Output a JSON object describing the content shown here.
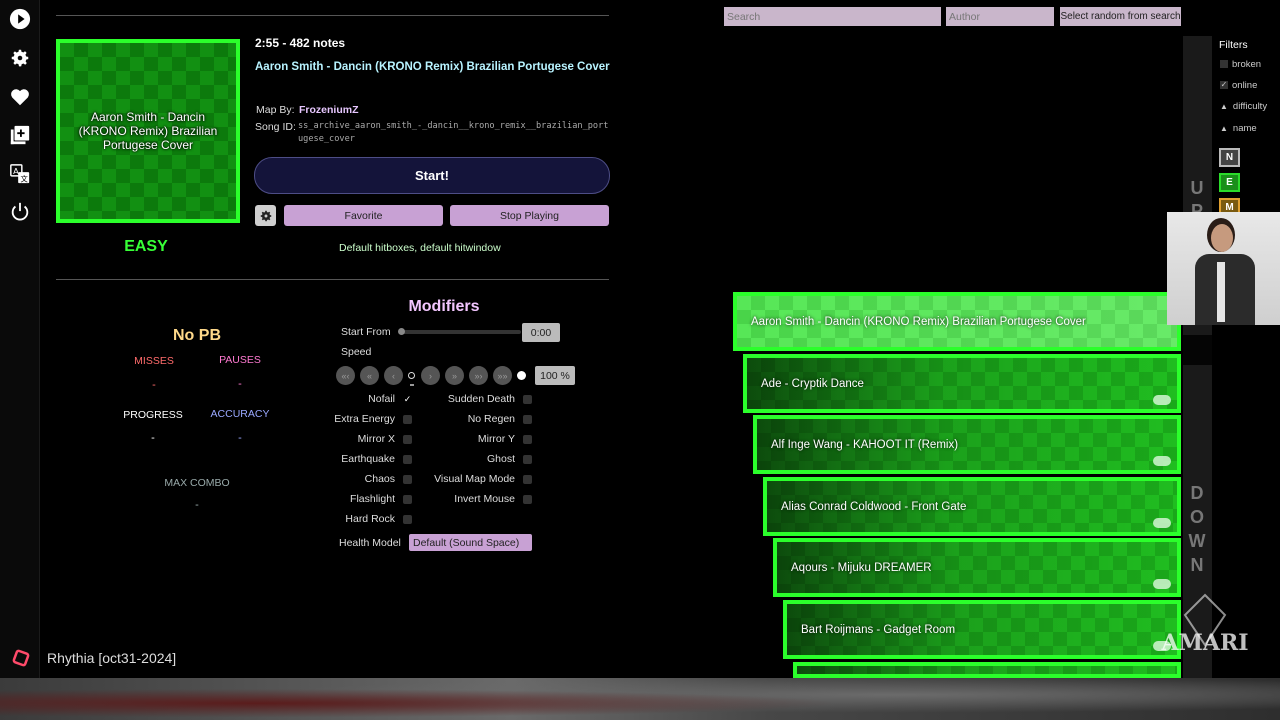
{
  "nav": {
    "items": [
      {
        "name": "play-icon"
      },
      {
        "name": "gear-icon"
      },
      {
        "name": "heart-icon"
      },
      {
        "name": "add-map-icon"
      },
      {
        "name": "translate-icon"
      },
      {
        "name": "power-icon"
      }
    ]
  },
  "details": {
    "cover_title": "Aaron Smith - Dancin (KRONO Remix) Brazilian Portugese Cover",
    "difficulty": "EASY",
    "duration_notes": "2:55 - 482 notes",
    "title": "Aaron Smith - Dancin (KRONO Remix) Brazilian Portugese Cover",
    "map_by_label": "Map By:",
    "map_by": "FrozeniumZ",
    "song_id_label": "Song ID:",
    "song_id": "ss_archive_aaron_smith_-_dancin__krono_remix__brazilian_portugese_cover",
    "start_label": "Start!",
    "favorite_label": "Favorite",
    "stop_label": "Stop Playing",
    "hitbox_note": "Default hitboxes, default hitwindow"
  },
  "stats": {
    "pb": "No PB",
    "misses_label": "MISSES",
    "misses": "-",
    "pauses_label": "PAUSES",
    "pauses": "-",
    "progress_label": "PROGRESS",
    "progress": "-",
    "accuracy_label": "ACCURACY",
    "accuracy": "-",
    "max_combo_label": "MAX COMBO",
    "max_combo": "-"
  },
  "modifiers": {
    "title": "Modifiers",
    "start_from_label": "Start From",
    "start_from": "0:00",
    "start_from_position": 0,
    "speed_label": "Speed",
    "speed_value": "100 %",
    "left_col": [
      {
        "label": "Nofail",
        "checked": "✓"
      },
      {
        "label": "Extra Energy",
        "checked": ""
      },
      {
        "label": "Mirror X",
        "checked": ""
      },
      {
        "label": "Earthquake",
        "checked": ""
      },
      {
        "label": "Chaos",
        "checked": ""
      },
      {
        "label": "Flashlight",
        "checked": ""
      },
      {
        "label": "Hard Rock",
        "checked": ""
      }
    ],
    "right_col": [
      {
        "label": "Sudden Death",
        "checked": ""
      },
      {
        "label": "No Regen",
        "checked": ""
      },
      {
        "label": "Mirror Y",
        "checked": ""
      },
      {
        "label": "Ghost",
        "checked": ""
      },
      {
        "label": "Visual Map Mode",
        "checked": ""
      },
      {
        "label": "Invert Mouse",
        "checked": ""
      }
    ],
    "health_label": "Health Model",
    "health_value": "Default (Sound Space)"
  },
  "search": {
    "search_placeholder": "Search",
    "author_placeholder": "Author",
    "random_label": "Select random from search"
  },
  "filters": {
    "title": "Filters",
    "broken": "broken",
    "broken_checked": "",
    "online": "online",
    "online_checked": "✓",
    "difficulty": "difficulty",
    "name": "name",
    "diff_buttons": [
      {
        "letter": "N",
        "color": "#bbbbbb"
      },
      {
        "letter": "E",
        "color": "#2bdc2b"
      },
      {
        "letter": "M",
        "color": "#e0a030"
      }
    ],
    "up_letters": [
      "U",
      "P"
    ],
    "down_letters": [
      "D",
      "O",
      "W",
      "N"
    ]
  },
  "songs": [
    "Aaron Smith - Dancin (KRONO Remix) Brazilian Portugese Cover",
    "Ade - Cryptik Dance",
    "Alf Inge Wang - KAHOOT IT (Remix)",
    "Alias Conrad Coldwood - Front Gate",
    "Aqours - Mijuku DREAMER",
    "Bart Roijmans - Gadget Room"
  ],
  "footer": {
    "app_name": "Rhythia [oct31-2024]"
  },
  "watermark": {
    "text": "AMARI"
  }
}
